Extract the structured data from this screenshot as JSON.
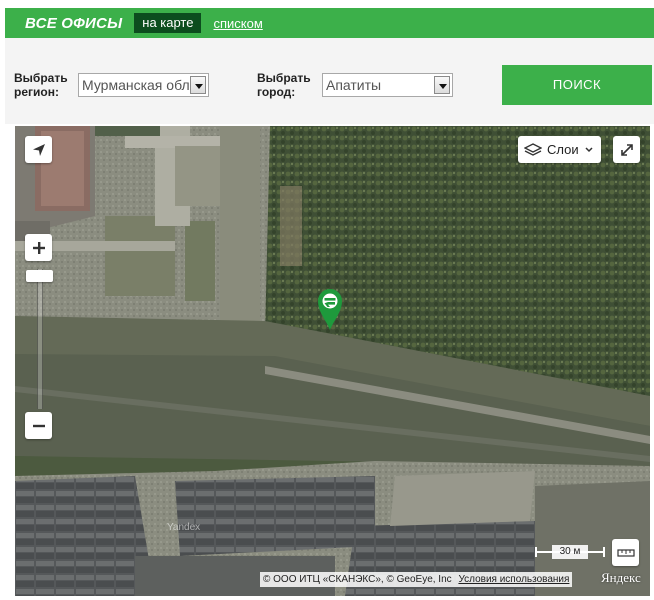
{
  "header": {
    "title": "ВСЕ ОФИСЫ",
    "tab_map": "на карте",
    "tab_list": "списком"
  },
  "filters": {
    "region_label_line1": "Выбрать",
    "region_label_line2": "регион:",
    "region_value": "Мурманская обл",
    "city_label_line1": "Выбрать",
    "city_label_line2": "город:",
    "city_value": "Апатиты",
    "search_label": "ПОИСК"
  },
  "map": {
    "layers_label": "Слои",
    "scale_label": "30 м",
    "copyright": "© ООО ИТЦ «СКАНЭКС», © GeoEye, Inc",
    "terms_link": "Условия использования",
    "logo": "Яндекс",
    "watermark": "Yandex",
    "icons": [
      "locate-icon",
      "layers-icon",
      "chevron-down-icon",
      "fullscreen-icon",
      "zoom-in-icon",
      "zoom-out-icon",
      "ruler-icon",
      "office-marker-icon"
    ]
  },
  "colors": {
    "brand_green": "#3cb04a",
    "tab_active_bg": "#0c4d1e",
    "marker_green": "#1e9a3c"
  }
}
